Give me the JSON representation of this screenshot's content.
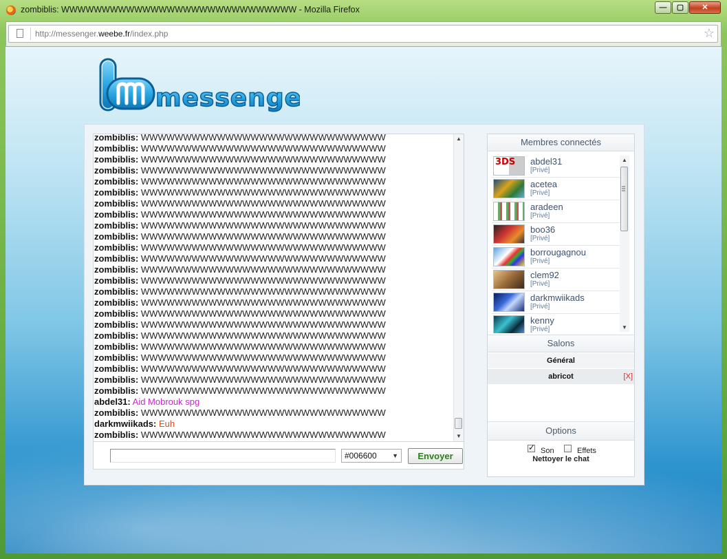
{
  "window": {
    "title": "zombiblis: WWWWWWWWWWWWWWWWWWWWWWWWWWWWW - Mozilla Firefox",
    "minimize_glyph": "—",
    "maximize_glyph": "▢",
    "close_glyph": "✕"
  },
  "address_bar": {
    "url_prefix": "http://messenger.",
    "url_domain": "weebe.fr",
    "url_suffix": "/index.php"
  },
  "logo": {
    "text": "messenger"
  },
  "chat": {
    "messages": [
      {
        "nick": "zombiblis:",
        "text": "WWWWWWWWWWWWWWWWWWWWWWWWWWWWW",
        "color": "#222222"
      },
      {
        "nick": "zombiblis:",
        "text": "WWWWWWWWWWWWWWWWWWWWWWWWWWWWW",
        "color": "#222222"
      },
      {
        "nick": "zombiblis:",
        "text": "WWWWWWWWWWWWWWWWWWWWWWWWWWWWW",
        "color": "#222222"
      },
      {
        "nick": "zombiblis:",
        "text": "WWWWWWWWWWWWWWWWWWWWWWWWWWWWW",
        "color": "#222222"
      },
      {
        "nick": "zombiblis:",
        "text": "WWWWWWWWWWWWWWWWWWWWWWWWWWWWW",
        "color": "#222222"
      },
      {
        "nick": "zombiblis:",
        "text": "WWWWWWWWWWWWWWWWWWWWWWWWWWWWW",
        "color": "#222222"
      },
      {
        "nick": "zombiblis:",
        "text": "WWWWWWWWWWWWWWWWWWWWWWWWWWWWW",
        "color": "#222222"
      },
      {
        "nick": "zombiblis:",
        "text": "WWWWWWWWWWWWWWWWWWWWWWWWWWWWW",
        "color": "#222222"
      },
      {
        "nick": "zombiblis:",
        "text": "WWWWWWWWWWWWWWWWWWWWWWWWWWWWW",
        "color": "#222222"
      },
      {
        "nick": "zombiblis:",
        "text": "WWWWWWWWWWWWWWWWWWWWWWWWWWWWW",
        "color": "#222222"
      },
      {
        "nick": "zombiblis:",
        "text": "WWWWWWWWWWWWWWWWWWWWWWWWWWWWW",
        "color": "#222222"
      },
      {
        "nick": "zombiblis:",
        "text": "WWWWWWWWWWWWWWWWWWWWWWWWWWWWW",
        "color": "#222222"
      },
      {
        "nick": "zombiblis:",
        "text": "WWWWWWWWWWWWWWWWWWWWWWWWWWWWW",
        "color": "#222222"
      },
      {
        "nick": "zombiblis:",
        "text": "WWWWWWWWWWWWWWWWWWWWWWWWWWWWW",
        "color": "#222222"
      },
      {
        "nick": "zombiblis:",
        "text": "WWWWWWWWWWWWWWWWWWWWWWWWWWWWW",
        "color": "#222222"
      },
      {
        "nick": "zombiblis:",
        "text": "WWWWWWWWWWWWWWWWWWWWWWWWWWWWW",
        "color": "#222222"
      },
      {
        "nick": "zombiblis:",
        "text": "WWWWWWWWWWWWWWWWWWWWWWWWWWWWW",
        "color": "#222222"
      },
      {
        "nick": "zombiblis:",
        "text": "WWWWWWWWWWWWWWWWWWWWWWWWWWWWW",
        "color": "#222222"
      },
      {
        "nick": "zombiblis:",
        "text": "WWWWWWWWWWWWWWWWWWWWWWWWWWWWW",
        "color": "#222222"
      },
      {
        "nick": "zombiblis:",
        "text": "WWWWWWWWWWWWWWWWWWWWWWWWWWWWW",
        "color": "#222222"
      },
      {
        "nick": "zombiblis:",
        "text": "WWWWWWWWWWWWWWWWWWWWWWWWWWWWW",
        "color": "#222222"
      },
      {
        "nick": "zombiblis:",
        "text": "WWWWWWWWWWWWWWWWWWWWWWWWWWWWW",
        "color": "#222222"
      },
      {
        "nick": "zombiblis:",
        "text": "WWWWWWWWWWWWWWWWWWWWWWWWWWWWW",
        "color": "#222222"
      },
      {
        "nick": "zombiblis:",
        "text": "WWWWWWWWWWWWWWWWWWWWWWWWWWWWW",
        "color": "#222222"
      },
      {
        "nick": "abdel31:",
        "text": "Aid Mobrouk spg",
        "color": "#cc22cc"
      },
      {
        "nick": "zombiblis:",
        "text": "WWWWWWWWWWWWWWWWWWWWWWWWWWWWW",
        "color": "#222222"
      },
      {
        "nick": "darkmwiikads:",
        "text": "Euh",
        "color": "#e04a1a"
      },
      {
        "nick": "zombiblis:",
        "text": "WWWWWWWWWWWWWWWWWWWWWWWWWWWWW",
        "color": "#222222"
      }
    ],
    "input_value": "",
    "color_select": "#006600",
    "send_label": "Envoyer"
  },
  "members": {
    "header": "Membres connectés",
    "list": [
      {
        "name": "abdel31",
        "status": "[Privé]",
        "avatar_label": "3DS"
      },
      {
        "name": "acetea",
        "status": "[Privé]",
        "avatar_label": ""
      },
      {
        "name": "aradeen",
        "status": "[Privé]",
        "avatar_label": ""
      },
      {
        "name": "boo36",
        "status": "[Privé]",
        "avatar_label": ""
      },
      {
        "name": "borrougagnou",
        "status": "[Privé]",
        "avatar_label": ""
      },
      {
        "name": "clem92",
        "status": "[Privé]",
        "avatar_label": ""
      },
      {
        "name": "darkmwiikads",
        "status": "[Privé]",
        "avatar_label": ""
      },
      {
        "name": "kenny",
        "status": "[Privé]",
        "avatar_label": ""
      }
    ]
  },
  "rooms": {
    "header": "Salons",
    "list": [
      {
        "name": "Général",
        "close": ""
      },
      {
        "name": "abricot",
        "close": "[X]"
      }
    ]
  },
  "options": {
    "header": "Options",
    "sound_label": "Son",
    "sound_checked": true,
    "effects_label": "Effets",
    "effects_checked": false,
    "clear_label": "Nettoyer le chat"
  }
}
